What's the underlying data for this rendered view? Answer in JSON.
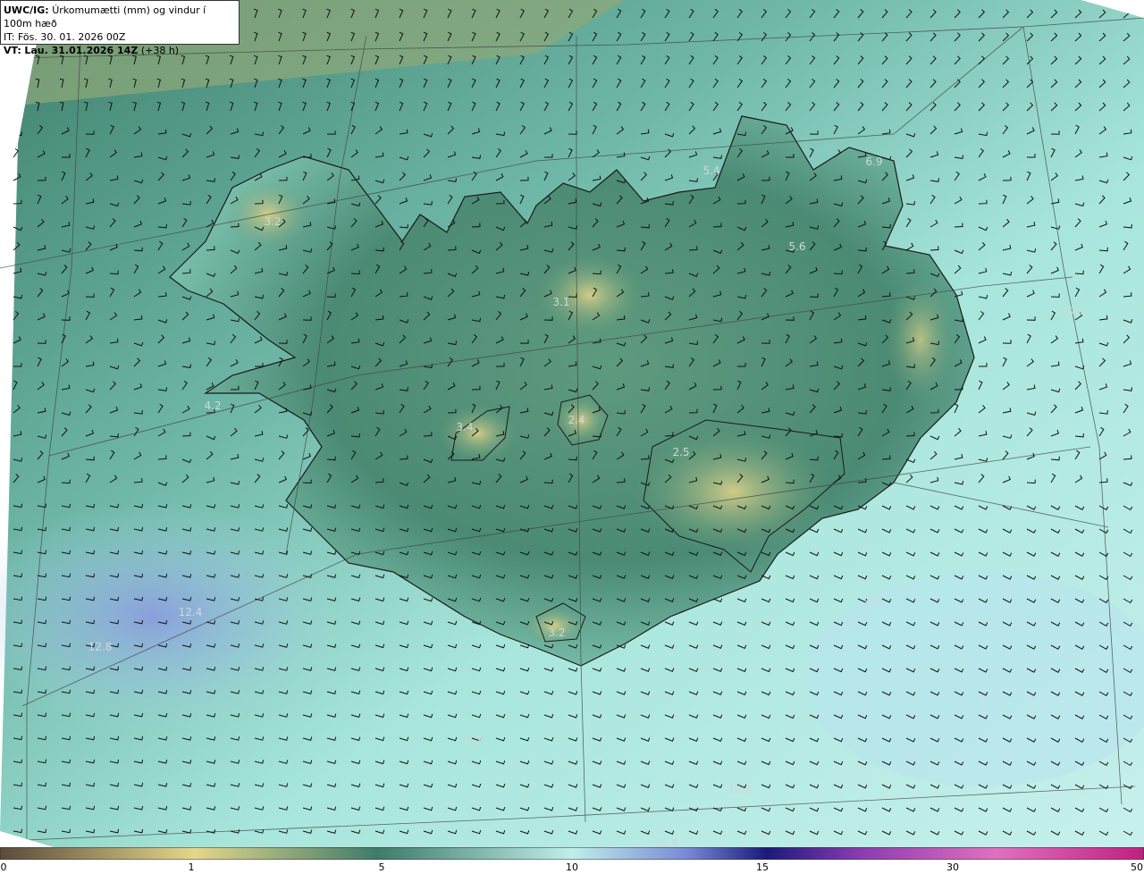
{
  "header": {
    "model_label": "UWC/IG:",
    "title": "Úrkomumætti (mm) og vindur í 100m hæð",
    "it_label": "IT:",
    "it_value": "Fös. 30. 01. 2026 00Z",
    "vt_label": "VT:",
    "vt_value": "Lau. 31.01.2026 14Z",
    "vt_lead": "(+38 h)"
  },
  "map_values": [
    {
      "text": "3.2"
    },
    {
      "text": "3.1"
    },
    {
      "text": "4.2"
    },
    {
      "text": "3.4"
    },
    {
      "text": "2.4"
    },
    {
      "text": "2.5"
    },
    {
      "text": "3.2"
    },
    {
      "text": "5.6"
    },
    {
      "text": "6.9"
    },
    {
      "text": "10.0"
    },
    {
      "text": "12.4"
    },
    {
      "text": "12.8"
    },
    {
      "text": "9.0"
    },
    {
      "text": "10.6"
    },
    {
      "text": "10.5"
    },
    {
      "text": "9.7"
    },
    {
      "text": "5.4"
    }
  ],
  "colorbar": {
    "ticks": [
      "0",
      "1",
      "5",
      "10",
      "15",
      "30",
      "50"
    ],
    "colors": {
      "brown": "#5a4a3a",
      "yellow": "#e3d78a",
      "green": "#5e9a7e",
      "teal": "#3f7a6a",
      "cyan": "#bfeeea",
      "blue": "#7a8ad6",
      "navy": "#1a1a7a",
      "purple": "#8a3ab0",
      "pink": "#e070c0",
      "magenta": "#c02080"
    }
  }
}
